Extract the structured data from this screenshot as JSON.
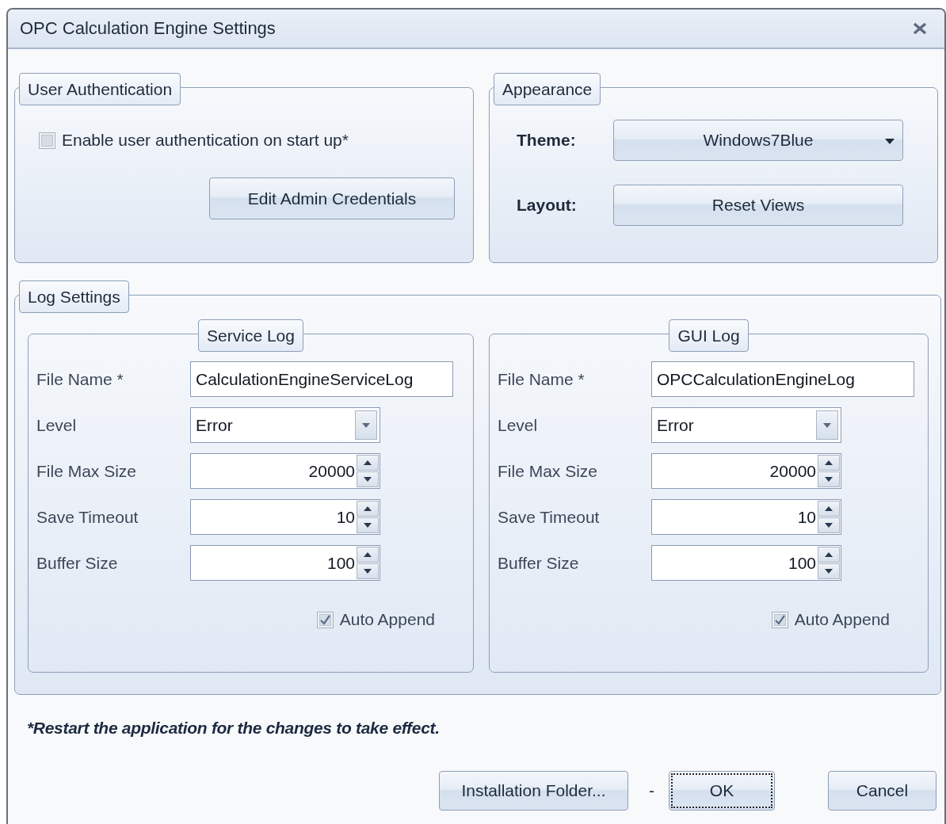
{
  "window": {
    "title": "OPC Calculation Engine Settings"
  },
  "user_authentication": {
    "title": "User Authentication",
    "checkbox": {
      "label": "Enable user authentication on start up*",
      "checked": false
    },
    "button": "Edit Admin Credentials"
  },
  "appearance": {
    "title": "Appearance",
    "theme": {
      "label": "Theme:",
      "value": "Windows7Blue"
    },
    "layout": {
      "label": "Layout:",
      "button": "Reset Views"
    }
  },
  "log_settings": {
    "title": "Log Settings",
    "panels": [
      {
        "title": "Service Log",
        "fields": [
          {
            "kind": "text",
            "label": "File Name *",
            "value": "CalculationEngineServiceLog"
          },
          {
            "kind": "dropdown",
            "label": "Level",
            "value": "Error"
          },
          {
            "kind": "spinner",
            "label": "File Max Size",
            "value": "20000"
          },
          {
            "kind": "spinner",
            "label": "Save Timeout",
            "value": "10"
          },
          {
            "kind": "spinner",
            "label": "Buffer Size",
            "value": "100"
          }
        ],
        "auto_append": {
          "label": "Auto Append",
          "checked": true
        }
      },
      {
        "title": "GUI Log",
        "fields": [
          {
            "kind": "text",
            "label": "File Name *",
            "value": "OPCCalculationEngineLog"
          },
          {
            "kind": "dropdown",
            "label": "Level",
            "value": "Error"
          },
          {
            "kind": "spinner",
            "label": "File Max Size",
            "value": "20000"
          },
          {
            "kind": "spinner",
            "label": "Save Timeout",
            "value": "10"
          },
          {
            "kind": "spinner",
            "label": "Buffer Size",
            "value": "100"
          }
        ],
        "auto_append": {
          "label": "Auto Append",
          "checked": true
        }
      }
    ]
  },
  "note": "*Restart the application for the changes to take effect.",
  "buttons": [
    {
      "kind": "button",
      "label": "Installation Folder...",
      "focused": false
    },
    {
      "kind": "text",
      "label": "-"
    },
    {
      "kind": "button",
      "label": "OK",
      "focused": true
    },
    {
      "kind": "button",
      "label": "Cancel",
      "focused": false
    }
  ]
}
